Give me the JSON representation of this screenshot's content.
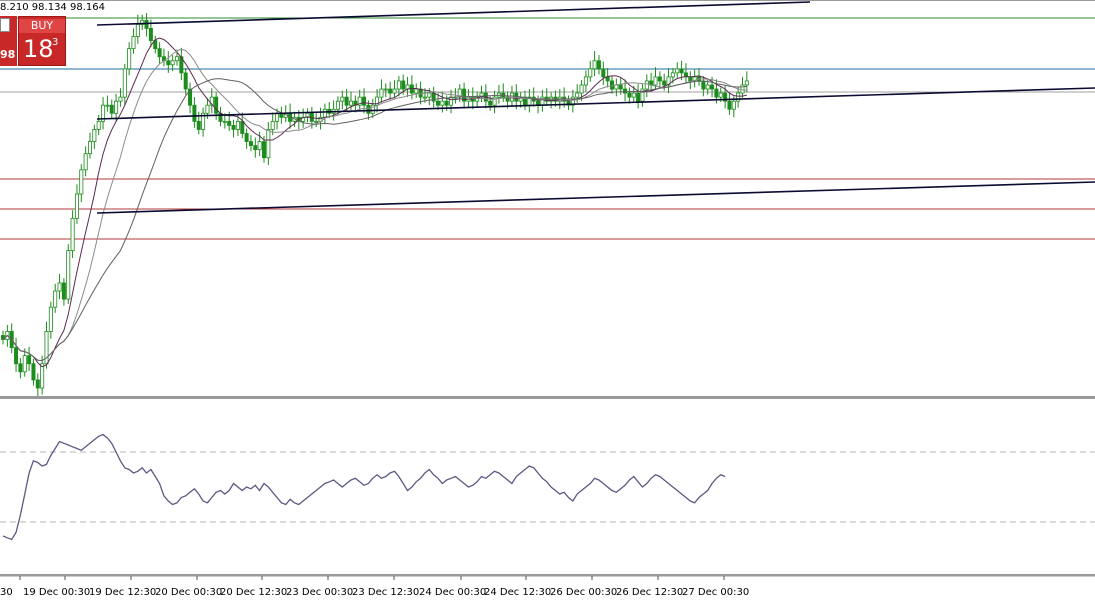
{
  "header": {
    "ohlc_text": "8.210 98.134 98.164"
  },
  "trade_panel": {
    "buy_label": "BUY",
    "price_small": "98",
    "price_big": "18",
    "price_sup": "3"
  },
  "colors": {
    "candle": "#1c8c1c",
    "ma_dark": "#5e2a52",
    "ma_gray1": "#8c8c8c",
    "ma_gray2": "#606060",
    "trendline": "#0a0a32",
    "level_green": "#2e8b2e",
    "level_blue": "#1e6ea0",
    "level_gray": "#a0a0a0",
    "level_red": "#b03a3a",
    "rsi": "#5a5a82",
    "separator": "#9a9a9a"
  },
  "chart_data": {
    "type": "candlestick",
    "price_axis_visible": false,
    "x_tick_labels": [
      "30",
      "19 Dec 00:30",
      "19 Dec 12:30",
      "20 Dec 00:30",
      "20 Dec 12:30",
      "23 Dec 00:30",
      "23 Dec 12:30",
      "24 Dec 00:30",
      "24 Dec 12:30",
      "26 Dec 00:30",
      "26 Dec 12:30",
      "27 Dec 00:30"
    ],
    "close_series": [
      97.68,
      97.7,
      97.66,
      97.62,
      97.6,
      97.64,
      97.62,
      97.58,
      97.56,
      97.62,
      97.7,
      97.76,
      97.8,
      97.82,
      97.78,
      97.9,
      97.98,
      98.04,
      98.1,
      98.14,
      98.17,
      98.2,
      98.22,
      98.26,
      98.26,
      98.24,
      98.27,
      98.28,
      98.35,
      98.4,
      98.43,
      98.46,
      98.47,
      98.45,
      98.42,
      98.4,
      98.38,
      98.37,
      98.36,
      98.37,
      98.38,
      98.34,
      98.3,
      98.26,
      98.22,
      98.2,
      98.24,
      98.26,
      98.28,
      98.24,
      98.22,
      98.22,
      98.21,
      98.2,
      98.22,
      98.19,
      98.17,
      98.16,
      98.15,
      98.17,
      98.13,
      98.2,
      98.22,
      98.24,
      98.23,
      98.24,
      98.22,
      98.23,
      98.22,
      98.23,
      98.24,
      98.22,
      98.22,
      98.23,
      98.25,
      98.24,
      98.25,
      98.27,
      98.28,
      98.26,
      98.27,
      98.26,
      98.28,
      98.26,
      98.24,
      98.26,
      98.28,
      98.3,
      98.3,
      98.29,
      98.3,
      98.32,
      98.3,
      98.31,
      98.29,
      98.3,
      98.28,
      98.28,
      98.29,
      98.27,
      98.26,
      98.27,
      98.26,
      98.28,
      98.28,
      98.3,
      98.27,
      98.28,
      98.27,
      98.28,
      98.29,
      98.27,
      98.26,
      98.28,
      98.29,
      98.28,
      98.27,
      98.29,
      98.27,
      98.28,
      98.26,
      98.28,
      98.27,
      98.26,
      98.28,
      98.27,
      98.28,
      98.27,
      98.28,
      98.27,
      98.26,
      98.28,
      98.29,
      98.31,
      98.33,
      98.35,
      98.37,
      98.35,
      98.33,
      98.32,
      98.3,
      98.31,
      98.3,
      98.29,
      98.28,
      98.29,
      98.27,
      98.3,
      98.32,
      98.31,
      98.33,
      98.32,
      98.31,
      98.33,
      98.34,
      98.35,
      98.34,
      98.33,
      98.32,
      98.33,
      98.32,
      98.3,
      98.31,
      98.3,
      98.28,
      98.29,
      98.27,
      98.25,
      98.27,
      98.29,
      98.31,
      98.32
    ],
    "moving_averages": 3,
    "horizontal_levels": 6,
    "trendlines": 3,
    "indicator": {
      "type": "line",
      "levels": [
        70,
        30
      ],
      "ylim": [
        0,
        100
      ],
      "values": [
        22,
        21,
        20,
        24,
        34,
        46,
        58,
        65,
        64,
        62,
        63,
        68,
        72,
        76,
        75,
        74,
        73,
        72,
        71,
        73,
        75,
        77,
        79,
        80,
        78,
        75,
        70,
        65,
        61,
        60,
        58,
        59,
        61,
        58,
        60,
        56,
        52,
        45,
        42,
        40,
        41,
        44,
        45,
        47,
        49,
        46,
        42,
        41,
        44,
        47,
        48,
        46,
        48,
        52,
        50,
        48,
        50,
        49,
        51,
        48,
        52,
        50,
        47,
        44,
        41,
        40,
        43,
        41,
        40,
        42,
        44,
        46,
        48,
        50,
        52,
        53,
        54,
        52,
        50,
        52,
        54,
        55,
        53,
        51,
        52,
        55,
        57,
        55,
        56,
        58,
        59,
        56,
        52,
        48,
        50,
        53,
        55,
        58,
        60,
        57,
        55,
        52,
        54,
        55,
        56,
        54,
        52,
        50,
        51,
        53,
        56,
        55,
        57,
        59,
        58,
        56,
        54,
        52,
        56,
        58,
        60,
        62,
        61,
        58,
        55,
        53,
        50,
        48,
        46,
        47,
        44,
        42,
        46,
        48,
        50,
        52,
        55,
        54,
        52,
        50,
        48,
        47,
        49,
        51,
        54,
        56,
        53,
        50,
        52,
        55,
        57,
        56,
        54,
        52,
        50,
        48,
        46,
        44,
        42,
        41,
        44,
        46,
        48,
        52,
        55,
        57,
        56
      ]
    }
  }
}
